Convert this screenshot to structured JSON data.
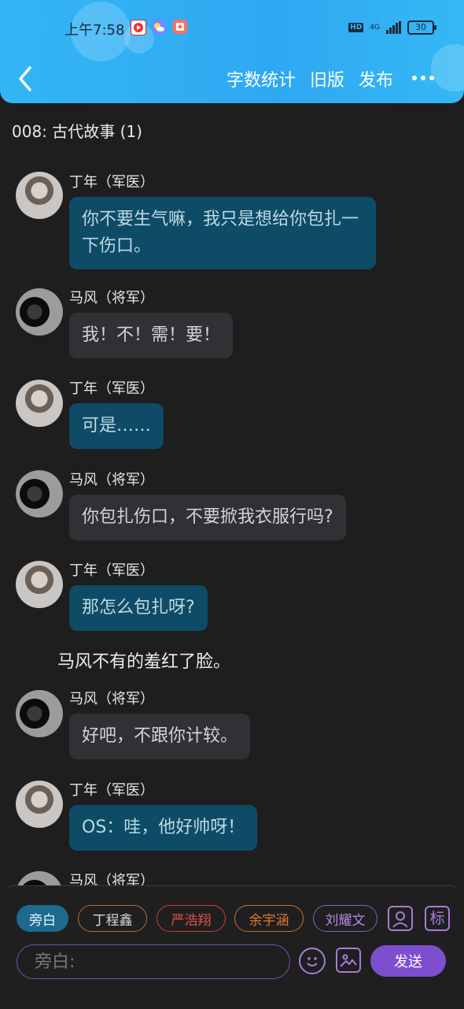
{
  "status_bar": {
    "time": "上午7:58",
    "network": "4G",
    "hd_badge": "HD",
    "battery": "30"
  },
  "nav": {
    "actions": [
      "字数统计",
      "旧版",
      "发布"
    ]
  },
  "chapter": {
    "title": "008: 古代故事 (1)"
  },
  "messages": [
    {
      "sender": "丁年（军医）",
      "text": "你不要生气嘛，我只是想给你包扎一下伤口。"
    },
    {
      "sender": "马风（将军）",
      "text": "我！不！需！要！"
    },
    {
      "sender": "丁年（军医）",
      "text": "可是……"
    },
    {
      "sender": "马风（将军）",
      "text": "你包扎伤口，不要掀我衣服行吗?"
    },
    {
      "sender": "丁年（军医）",
      "text": "那怎么包扎呀?"
    },
    {
      "narration": "马风不有的羞红了脸。"
    },
    {
      "sender": "马风（将军）",
      "text": "好吧，不跟你计较。"
    },
    {
      "sender": "丁年（军医）",
      "text": "OS：哇，他好帅呀！"
    },
    {
      "sender": "马风（将军）"
    }
  ],
  "role_chips": [
    "旁白",
    "丁程鑫",
    "严浩翔",
    "余宇涵",
    "刘耀文"
  ],
  "toolbar": {
    "mark_label": "标",
    "input_placeholder": "旁白:",
    "send_label": "发送"
  },
  "icons": {
    "back": "chevron-left-icon",
    "more": "more-dots-icon",
    "person": "person-icon",
    "emoji": "emoji-icon",
    "image": "image-icon"
  },
  "colors": {
    "header": "#33b6f5",
    "bubble_blue": "#0e4b66",
    "bubble_dark": "#2f3135",
    "accent_purple": "#7d4fcf"
  }
}
